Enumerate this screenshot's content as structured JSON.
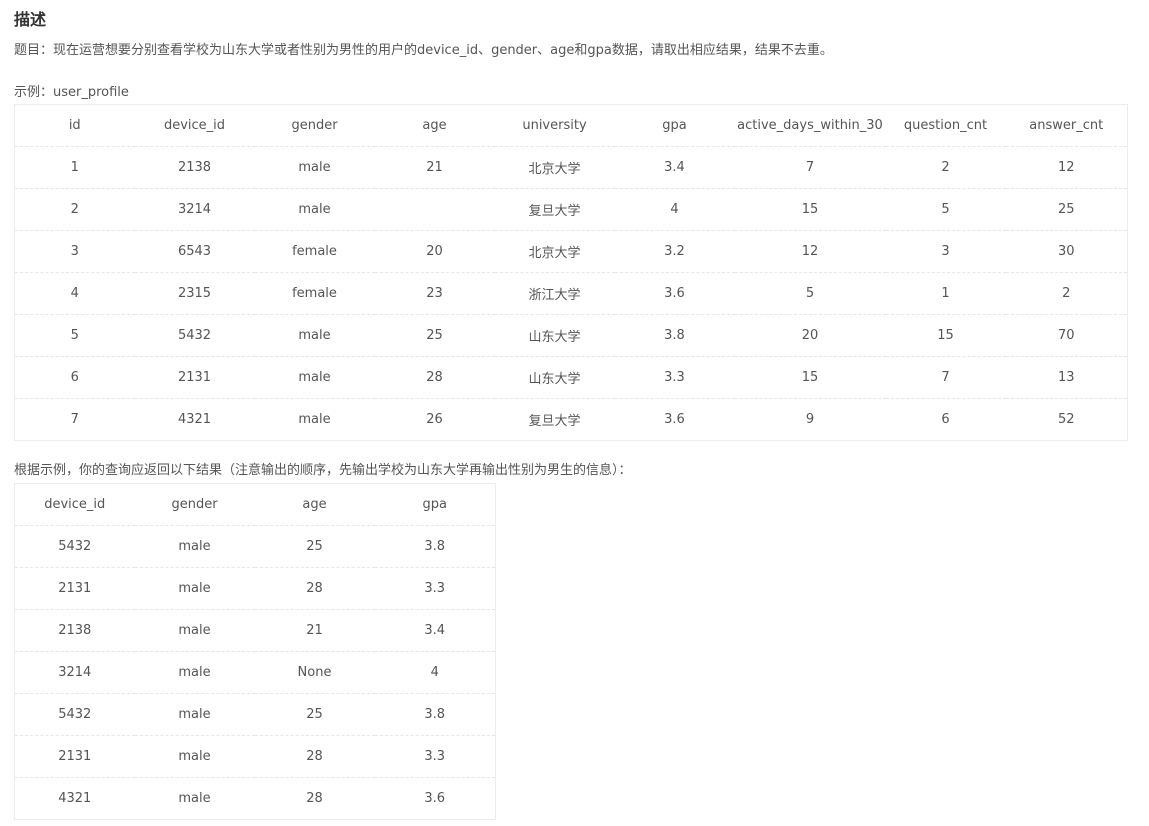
{
  "description": {
    "heading": "描述",
    "question": "题目：现在运营想要分别查看学校为山东大学或者性别为男性的用户的device_id、gender、age和gpa数据，请取出相应结果，结果不去重。",
    "example_label": "示例：user_profile",
    "result_label": "根据示例，你的查询应返回以下结果（注意输出的顺序，先输出学校为山东大学再输出性别为男生的信息）："
  },
  "example_table": {
    "columns": [
      "id",
      "device_id",
      "gender",
      "age",
      "university",
      "gpa",
      "active_days_within_30",
      "question_cnt",
      "answer_cnt"
    ],
    "rows": [
      [
        "1",
        "2138",
        "male",
        "21",
        "北京大学",
        "3.4",
        "7",
        "2",
        "12"
      ],
      [
        "2",
        "3214",
        "male",
        "",
        "复旦大学",
        "4",
        "15",
        "5",
        "25"
      ],
      [
        "3",
        "6543",
        "female",
        "20",
        "北京大学",
        "3.2",
        "12",
        "3",
        "30"
      ],
      [
        "4",
        "2315",
        "female",
        "23",
        "浙江大学",
        "3.6",
        "5",
        "1",
        "2"
      ],
      [
        "5",
        "5432",
        "male",
        "25",
        "山东大学",
        "3.8",
        "20",
        "15",
        "70"
      ],
      [
        "6",
        "2131",
        "male",
        "28",
        "山东大学",
        "3.3",
        "15",
        "7",
        "13"
      ],
      [
        "7",
        "4321",
        "male",
        "26",
        "复旦大学",
        "3.6",
        "9",
        "6",
        "52"
      ]
    ]
  },
  "result_table": {
    "columns": [
      "device_id",
      "gender",
      "age",
      "gpa"
    ],
    "rows": [
      [
        "5432",
        "male",
        "25",
        "3.8"
      ],
      [
        "2131",
        "male",
        "28",
        "3.3"
      ],
      [
        "2138",
        "male",
        "21",
        "3.4"
      ],
      [
        "3214",
        "male",
        "None",
        "4"
      ],
      [
        "5432",
        "male",
        "25",
        "3.8"
      ],
      [
        "2131",
        "male",
        "28",
        "3.3"
      ],
      [
        "4321",
        "male",
        "28",
        "3.6"
      ]
    ]
  }
}
